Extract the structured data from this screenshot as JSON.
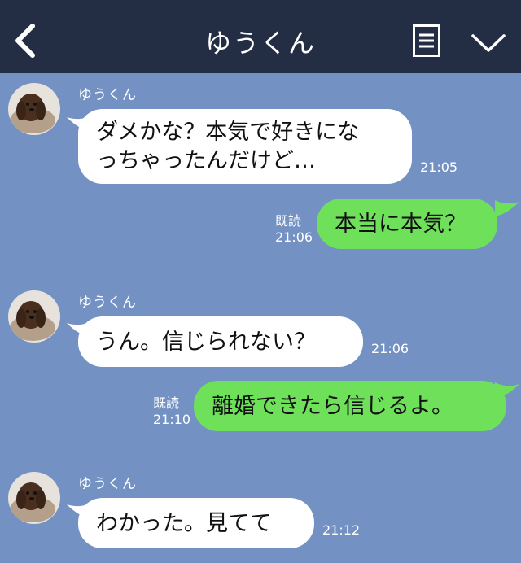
{
  "header": {
    "title": "ゆうくん",
    "back_icon": "chevron-left-icon",
    "menu_icon": "menu-icon",
    "collapse_icon": "chevron-down-icon"
  },
  "colors": {
    "header_bg": "#232d44",
    "chat_bg": "#7392c3",
    "incoming_bubble": "#ffffff",
    "outgoing_bubble": "#6ee05a"
  },
  "messages": [
    {
      "direction": "in",
      "sender": "ゆうくん",
      "lines": [
        "ダメかな？本気で好きにな",
        "っちゃったんだけど…"
      ],
      "time": "21:05"
    },
    {
      "direction": "out",
      "text": "本当に本気？",
      "read": "既読",
      "time": "21:06"
    },
    {
      "direction": "in",
      "sender": "ゆうくん",
      "lines": [
        "うん。信じられない？"
      ],
      "time": "21:06"
    },
    {
      "direction": "out",
      "text": "離婚できたら信じるよ。",
      "read": "既読",
      "time": "21:10"
    },
    {
      "direction": "in",
      "sender": "ゆうくん",
      "lines": [
        "わかった。見てて"
      ],
      "time": "21:12"
    }
  ]
}
